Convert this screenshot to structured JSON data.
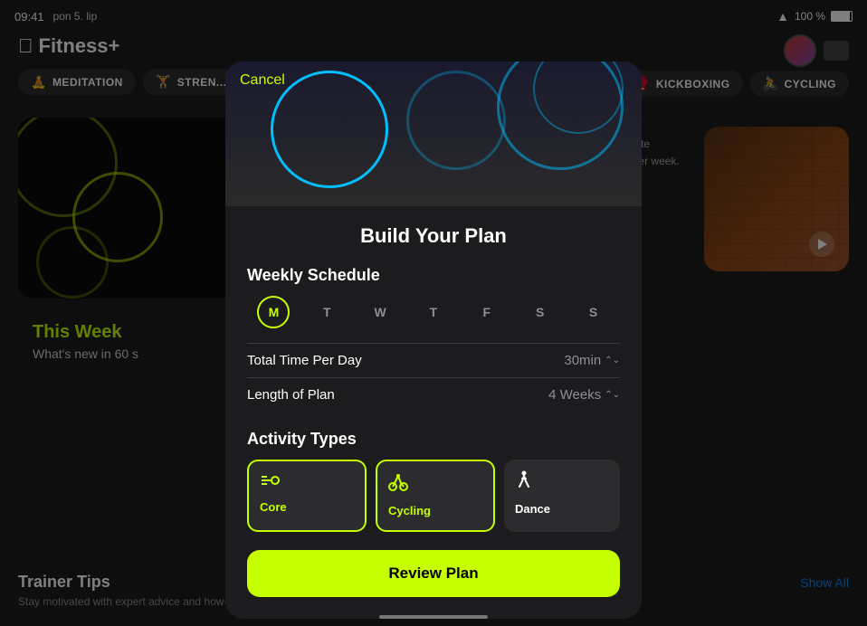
{
  "statusBar": {
    "time": "09:41",
    "date": "pon 5. lip",
    "battery": "100 %",
    "wifi": "WiFi"
  },
  "fitnessApp": {
    "logo": "Fitness+",
    "appleSymbol": "",
    "categories": [
      {
        "id": "meditation",
        "label": "MEDITATION",
        "icon": "🧘"
      },
      {
        "id": "strength",
        "label": "STREN...",
        "icon": "🏋"
      }
    ],
    "rightCategories": [
      {
        "id": "kickboxing",
        "label": "KICKBOXING",
        "icon": "🥊"
      },
      {
        "id": "cycling",
        "label": "CYCLING",
        "icon": "🚴"
      }
    ],
    "thisWeek": {
      "title": "This Week",
      "subtitle": "What's new in 60 s"
    },
    "trainerTips": {
      "title": "Trainer Tips",
      "showAll": "Show All",
      "subtitle": "Stay motivated with expert advice and how-to demos from the Fitness+ trainer team"
    },
    "planText": "routine with a plan\nfavorite activities and\nd week after week."
  },
  "modal": {
    "cancelLabel": "Cancel",
    "title": "Build Your Plan",
    "weeklySchedule": {
      "sectionTitle": "Weekly Schedule",
      "days": [
        {
          "letter": "M",
          "active": true
        },
        {
          "letter": "T",
          "active": false
        },
        {
          "letter": "W",
          "active": false
        },
        {
          "letter": "T",
          "active": false
        },
        {
          "letter": "F",
          "active": false
        },
        {
          "letter": "S",
          "active": false
        },
        {
          "letter": "S",
          "active": false
        }
      ],
      "totalTimeLabel": "Total Time Per Day",
      "totalTimeValue": "30min",
      "lengthLabel": "Length of Plan",
      "lengthValue": "4 Weeks"
    },
    "activityTypes": {
      "sectionTitle": "Activity Types",
      "items": [
        {
          "id": "core",
          "name": "Core",
          "icon": "⚡",
          "selected": true
        },
        {
          "id": "cycling",
          "name": "Cycling",
          "icon": "🚴",
          "selected": true
        },
        {
          "id": "dance",
          "name": "Dance",
          "icon": "🕺",
          "selected": false
        }
      ]
    },
    "reviewPlanLabel": "Review Plan"
  }
}
